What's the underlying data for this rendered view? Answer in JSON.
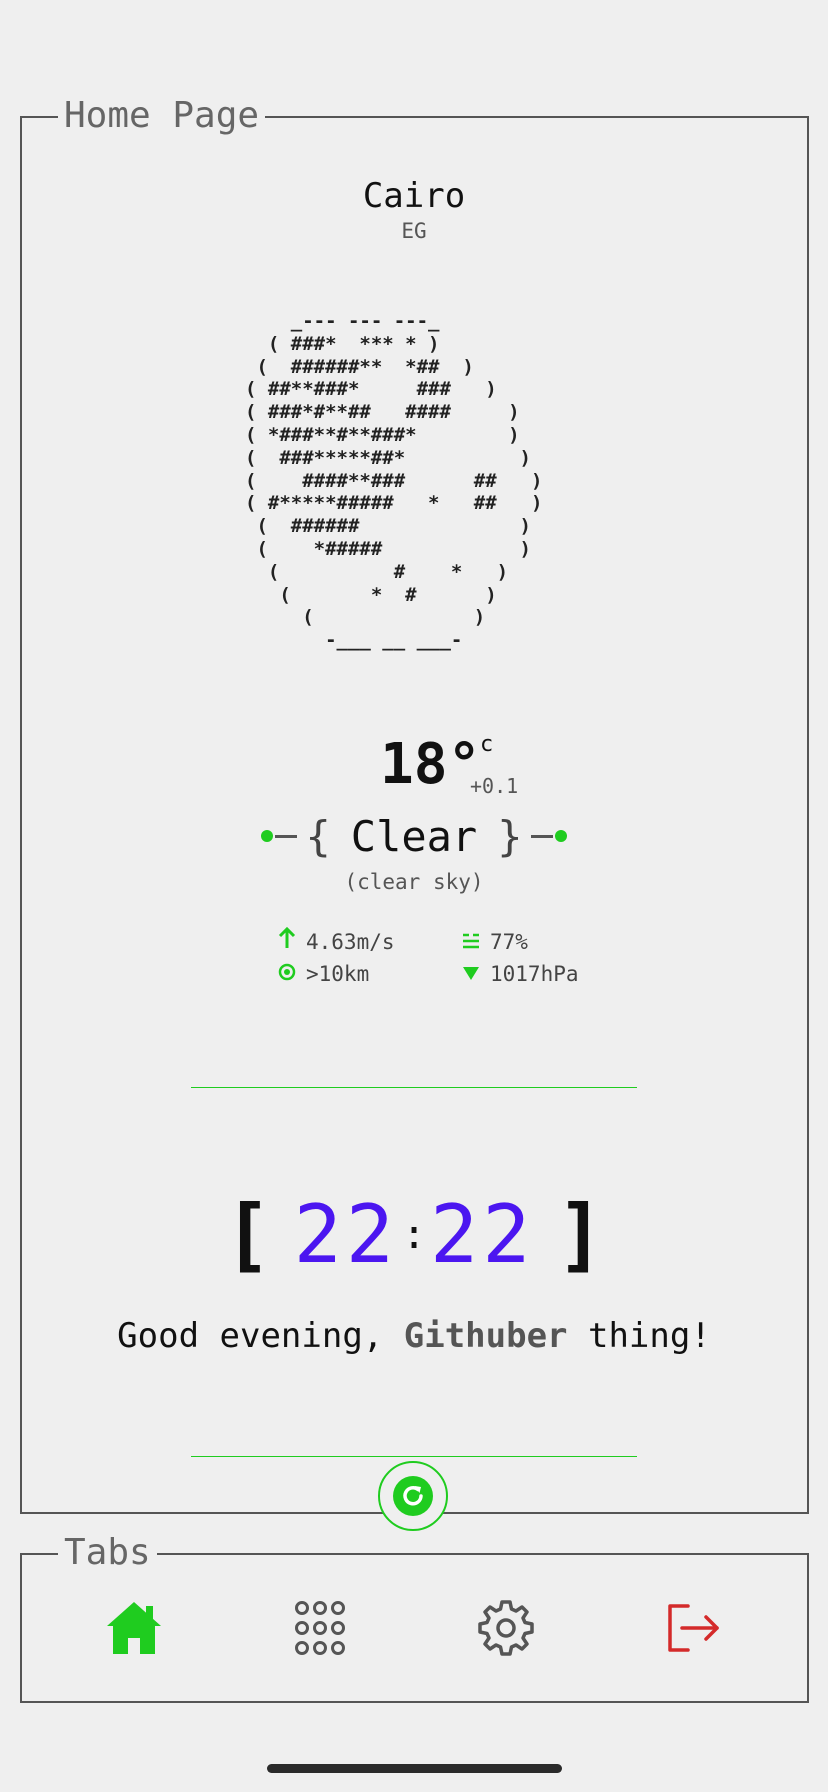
{
  "home": {
    "legend": "Home Page",
    "city": "Cairo",
    "country": "EG",
    "ascii_art": "    _--- --- ---_\n  ( ###*  *** * )\n (  ######**  *##  )\n( ##**###*     ###   )\n( ###*#**##   ####     )\n( *###**#**###*        )\n(  ###*****##*          )\n(    ####**###      ##   )\n( #*****#####   *   ##   )\n (  ######              )\n (    *#####            )\n  (          #    *   )\n   (       *  #      )\n     (              )\n       -___ __ ___-",
    "temperature": "18°",
    "temp_unit": "c",
    "temp_delta": "+0.1",
    "condition": "Clear",
    "condition_detail": "(clear sky)",
    "stats": {
      "wind": "4.63m/s",
      "humidity": "77%",
      "visibility": ">10km",
      "pressure": "1017hPa"
    },
    "clock": {
      "hours": "22",
      "minutes": "22",
      "separator": ":"
    },
    "greeting": {
      "prefix": "Good evening, ",
      "name": "Githuber",
      "suffix": " thing!"
    },
    "accent_color": "#1fcc1f",
    "clock_color": "#4b16f0"
  },
  "tabs": {
    "legend": "Tabs",
    "items": [
      {
        "icon": "home-icon",
        "active": true
      },
      {
        "icon": "apps-grid-icon",
        "active": false
      },
      {
        "icon": "gear-icon",
        "active": false
      },
      {
        "icon": "logout-icon",
        "active": false
      }
    ]
  }
}
